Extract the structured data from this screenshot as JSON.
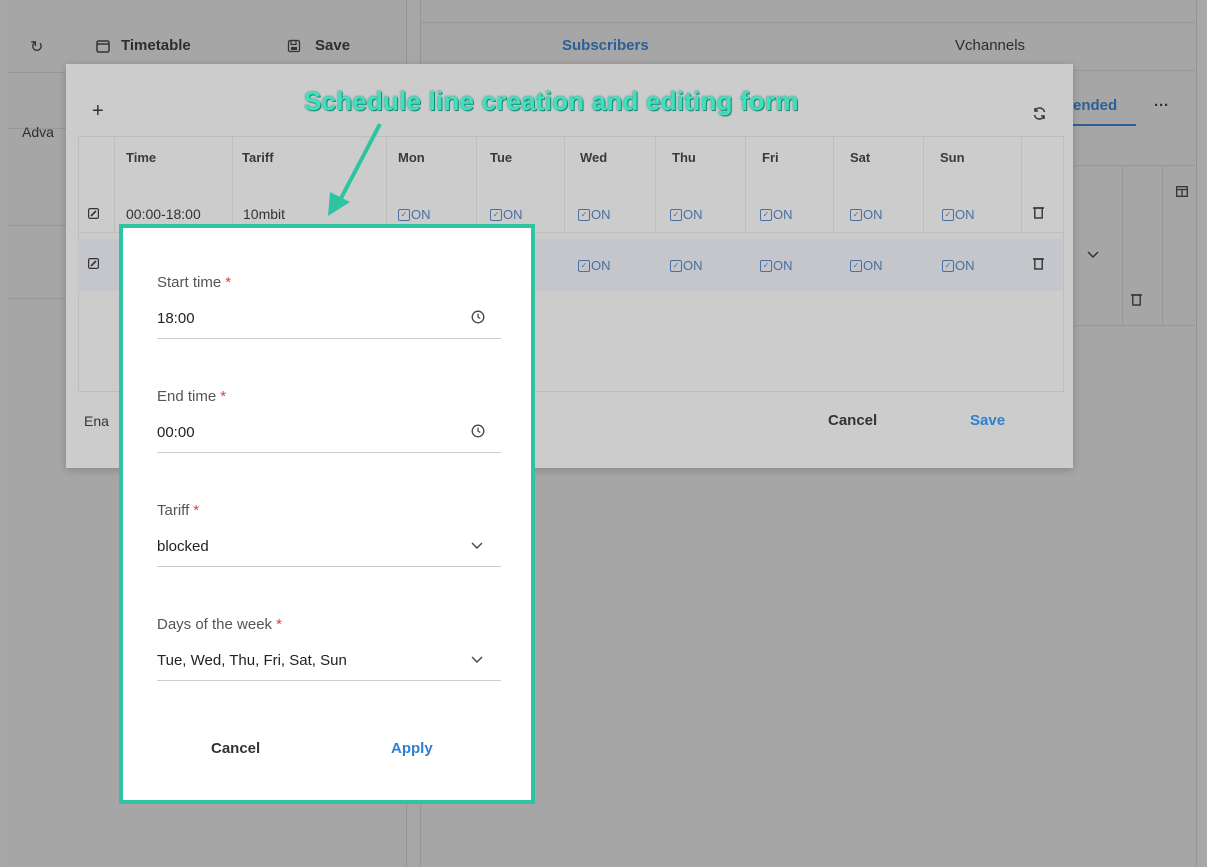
{
  "toolbar": {
    "timetable_label": "Timetable",
    "save_label": "Save"
  },
  "tabs": {
    "subscribers": "Subscribers",
    "vchannels": "Vchannels",
    "extended": "ended",
    "more": "···",
    "advanced_partial": "Adva"
  },
  "annotation": "Schedule line creation and editing form",
  "modal": {
    "columns": [
      "Time",
      "Tariff",
      "Mon",
      "Tue",
      "Wed",
      "Thu",
      "Fri",
      "Sat",
      "Sun"
    ],
    "rows": [
      {
        "time": "00:00-18:00",
        "tariff": "10mbit",
        "days": [
          "ON",
          "ON",
          "ON",
          "ON",
          "ON",
          "ON",
          "ON"
        ]
      },
      {
        "time": "",
        "tariff": "",
        "days": [
          "",
          "",
          "ON",
          "ON",
          "ON",
          "ON",
          "ON"
        ]
      }
    ],
    "enabled_partial": "Ena",
    "cancel_label": "Cancel",
    "save_label": "Save"
  },
  "form": {
    "start_time": {
      "label": "Start time",
      "value": "18:00"
    },
    "end_time": {
      "label": "End time",
      "value": "00:00"
    },
    "tariff": {
      "label": "Tariff",
      "value": "blocked"
    },
    "days": {
      "label": "Days of the week",
      "value": "Tue, Wed, Thu, Fri, Sat, Sun"
    },
    "required_mark": "*",
    "cancel_label": "Cancel",
    "apply_label": "Apply"
  },
  "colors": {
    "accent": "#2e7fd0",
    "highlight": "#2ec4a1",
    "required": "#e23b3b"
  }
}
